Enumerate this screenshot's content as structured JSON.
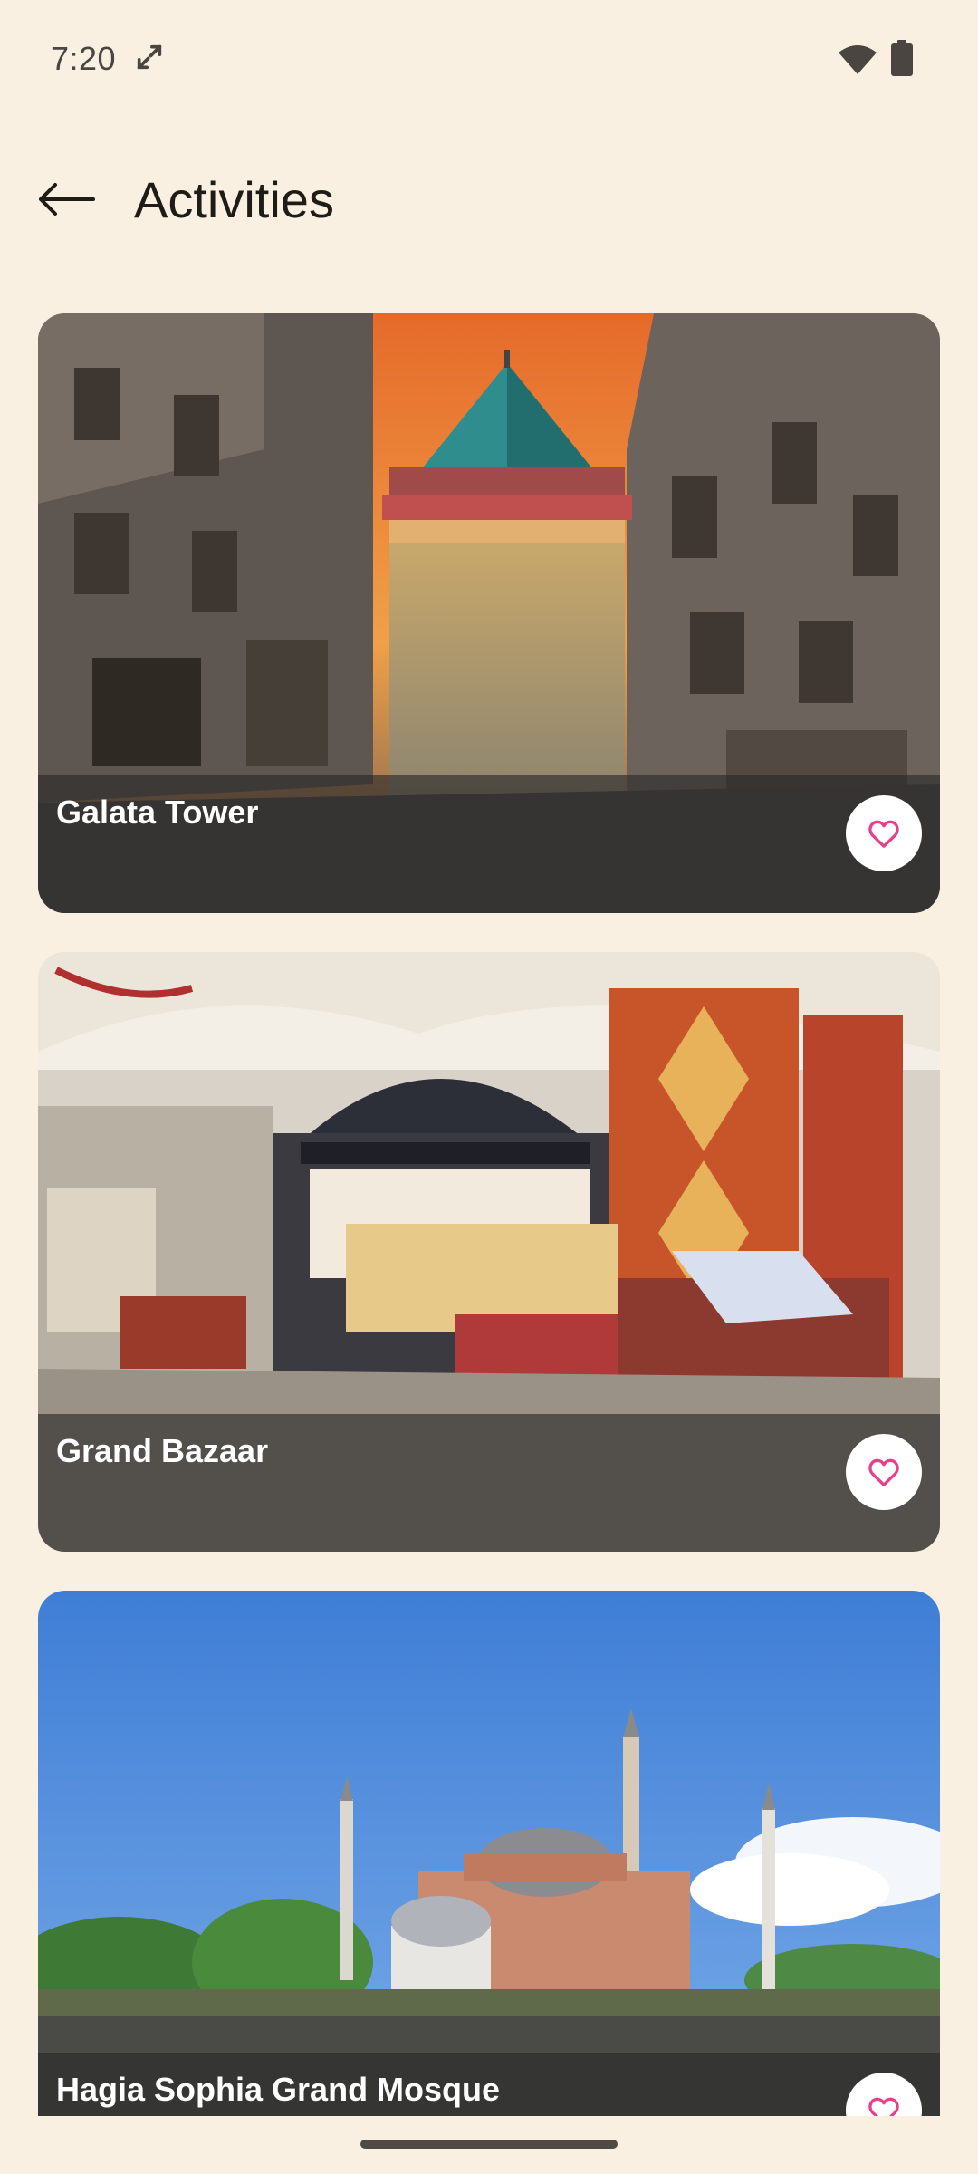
{
  "status_bar": {
    "time": "7:20",
    "icons": [
      "sync-icon",
      "wifi-icon",
      "battery-icon"
    ]
  },
  "app_bar": {
    "back_icon": "arrow-back-icon",
    "title": "Activities"
  },
  "activities": [
    {
      "name": "Galata Tower",
      "favorite_icon": "heart-outline-icon",
      "favorited": false
    },
    {
      "name": "Grand Bazaar",
      "favorite_icon": "heart-outline-icon",
      "favorited": false
    },
    {
      "name": "Hagia Sophia Grand Mosque",
      "favorite_icon": "heart-outline-icon",
      "favorited": false
    }
  ],
  "colors": {
    "background": "#f9f0e2",
    "heart_accent": "#e8418b",
    "card_overlay": "#282828"
  }
}
